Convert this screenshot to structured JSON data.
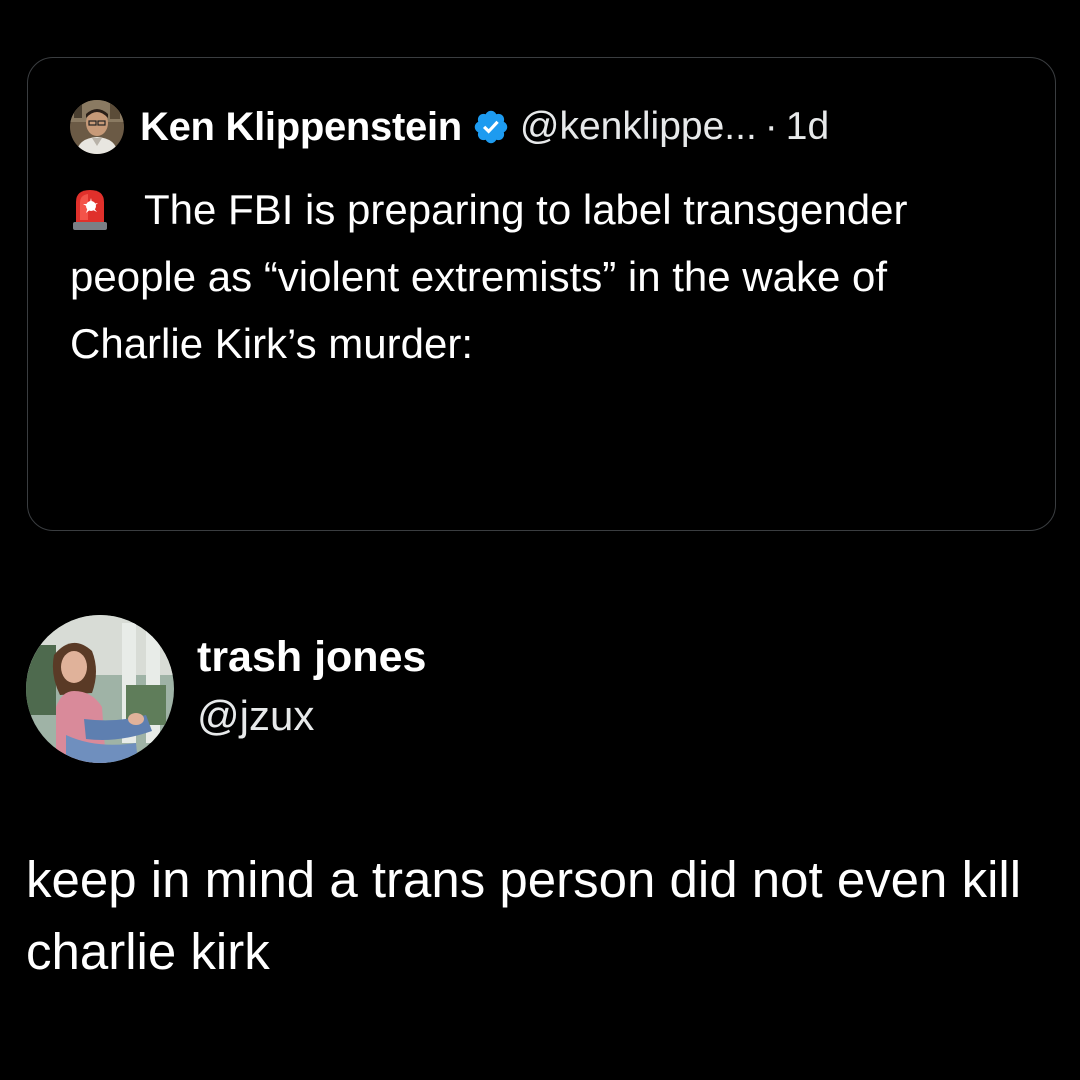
{
  "quoted_tweet": {
    "author_name": "Ken Klippenstein",
    "verified": true,
    "handle": "@kenklippe...",
    "separator": "·",
    "time": "1d",
    "text": "The FBI is preparing to label transgender people as “violent extremists” in the wake of Charlie Kirk’s murder:",
    "icons": {
      "avatar": "profile-photo-icon",
      "verified": "verified-badge-icon",
      "emoji": "siren-emoji-icon"
    }
  },
  "tweet": {
    "author_name": "trash jones",
    "handle": "@jzux",
    "text": "keep in mind a trans person did not even kill charlie kirk"
  },
  "colors": {
    "background": "#000000",
    "text": "#ffffff",
    "secondary_text": "#e7e9ea",
    "card_border": "#3a3d40",
    "verified_blue": "#1d9bf0",
    "siren_red": "#e0302b"
  }
}
